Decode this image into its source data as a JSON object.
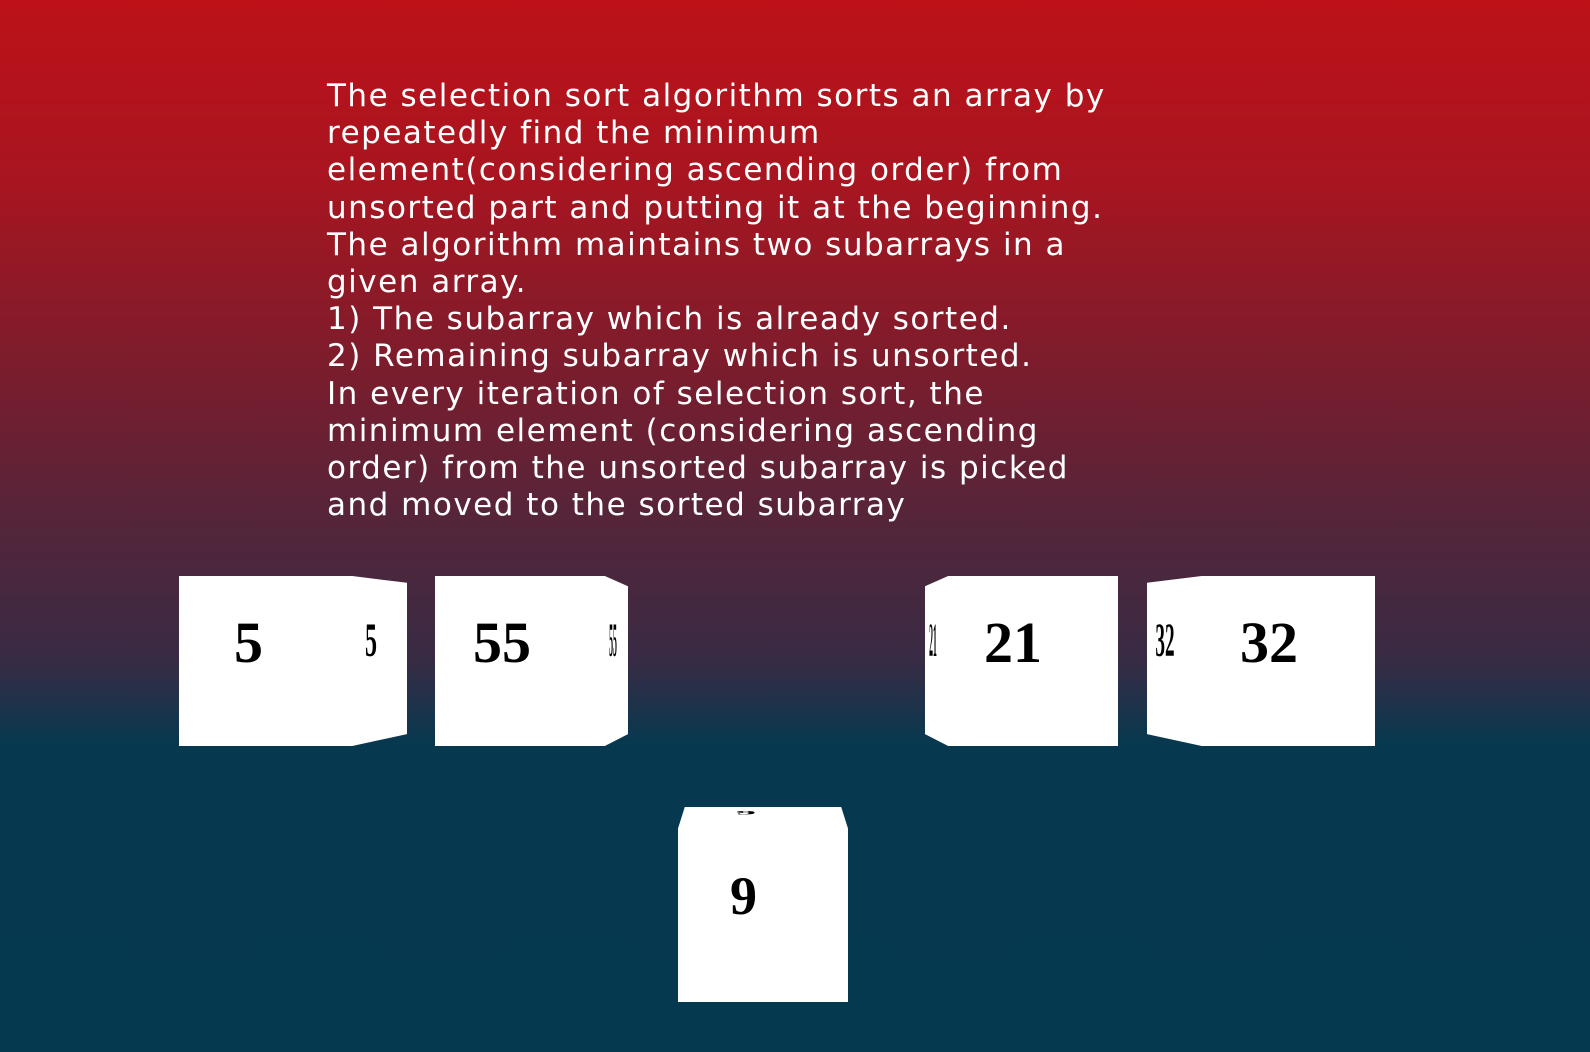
{
  "description": {
    "text": "The selection sort algorithm sorts an array by\nrepeatedly find the minimum\nelement(considering ascending order) from\nunsorted part and putting it at the beginning.\nThe algorithm maintains two subarrays in a\ngiven array.\n1) The subarray which is already sorted.\n2) Remaining subarray which is unsorted.\nIn every iteration of selection sort, the\nminimum element (considering ascending\norder) from the unsorted subarray is picked\nand moved to the sorted subarray"
  },
  "cubes": {
    "cube_1": {
      "value": "5"
    },
    "cube_2": {
      "value": "55"
    },
    "cube_3": {
      "value": "21"
    },
    "cube_4": {
      "value": "32"
    },
    "selected_cube": {
      "value": "9"
    }
  },
  "colors": {
    "background_top": "#bd1118",
    "background_bottom": "#05394f",
    "cube_face": "#ffffff",
    "text": "#ffffff"
  }
}
